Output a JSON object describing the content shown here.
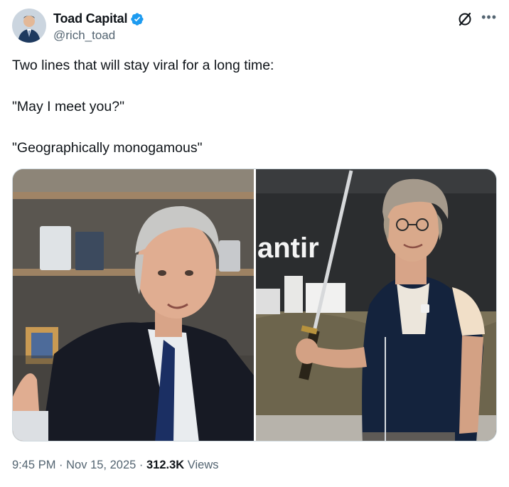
{
  "author": {
    "display_name": "Toad Capital",
    "handle": "@rich_toad",
    "verified": true,
    "avatar_icon": "profile-photo"
  },
  "tweet": {
    "lines": [
      "Two lines that will stay viral for a long time:",
      "\"May I meet you?\"",
      "\"Geographically monogamous\""
    ]
  },
  "media": {
    "count": 2,
    "left_photo": "man-in-suit-interview",
    "right_photo": "man-in-vest-holding-sword",
    "sign_text": "antir"
  },
  "meta": {
    "time": "9:45 PM",
    "separator": "·",
    "date": "Nov 15, 2025",
    "views_count": "312.3K",
    "views_label": "Views"
  },
  "colors": {
    "text": "#0f1419",
    "secondary": "#536471",
    "verified": "#1d9bf0",
    "border": "#cfd9de"
  }
}
